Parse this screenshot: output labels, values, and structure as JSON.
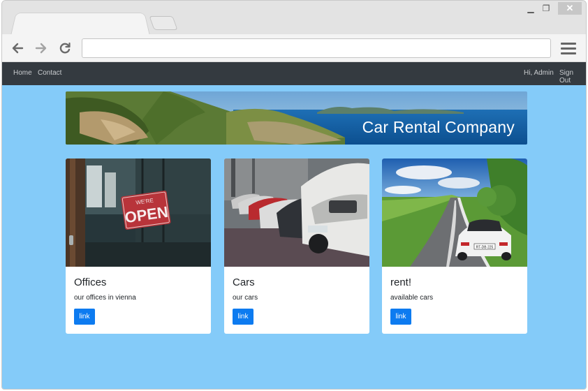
{
  "browser": {
    "address_value": "",
    "icons": {
      "back": "arrow-left-icon",
      "forward": "arrow-right-icon",
      "reload": "reload-icon",
      "menu": "hamburger-menu-icon",
      "minimize": "minimize-icon",
      "restore": "restore-icon",
      "close": "close-icon"
    }
  },
  "nav": {
    "home": "Home",
    "contact": "Contact",
    "greeting": "Hi, Admin",
    "signout": "Sign Out"
  },
  "banner": {
    "title": "Car Rental Company"
  },
  "cards": [
    {
      "title": "Offices",
      "text": "our offices in vienna",
      "button": "link"
    },
    {
      "title": "Cars",
      "text": "our cars",
      "button": "link"
    },
    {
      "title": "rent!",
      "text": "available cars",
      "button": "link"
    }
  ],
  "photo_texts": {
    "open_sign_top": "WE'RE",
    "open_sign_main": "OPEN",
    "plate": "RT-DB 225"
  },
  "colors": {
    "page_bg": "#84cbf9",
    "navbar": "#343a40",
    "button": "#0d7bf0"
  }
}
